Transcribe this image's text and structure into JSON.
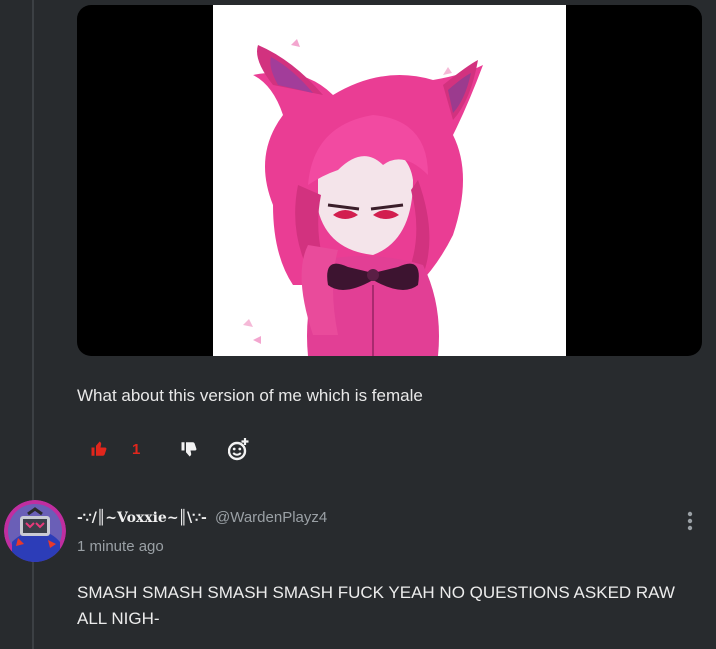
{
  "comment": {
    "text": "What about this version of me which is female",
    "like_count": "1",
    "colors": {
      "liked": "#e1261c",
      "text": "#e8e8e8",
      "muted": "#9aa0a5",
      "background": "#282b2e"
    },
    "icons": {
      "like": "thumbs-up-icon",
      "dislike": "thumbs-down-icon",
      "react": "add-reaction-icon"
    }
  },
  "reply": {
    "username": "-∵/║~Voxxie~║\\∵-",
    "handle": "@WardenPlayz4",
    "timestamp": "1 minute ago",
    "text": "SMASH SMASH SMASH SMASH FUCK YEAH NO QUESTIONS ASKED RAW ALL NIGH-",
    "icons": {
      "menu": "more-vertical-icon"
    }
  }
}
